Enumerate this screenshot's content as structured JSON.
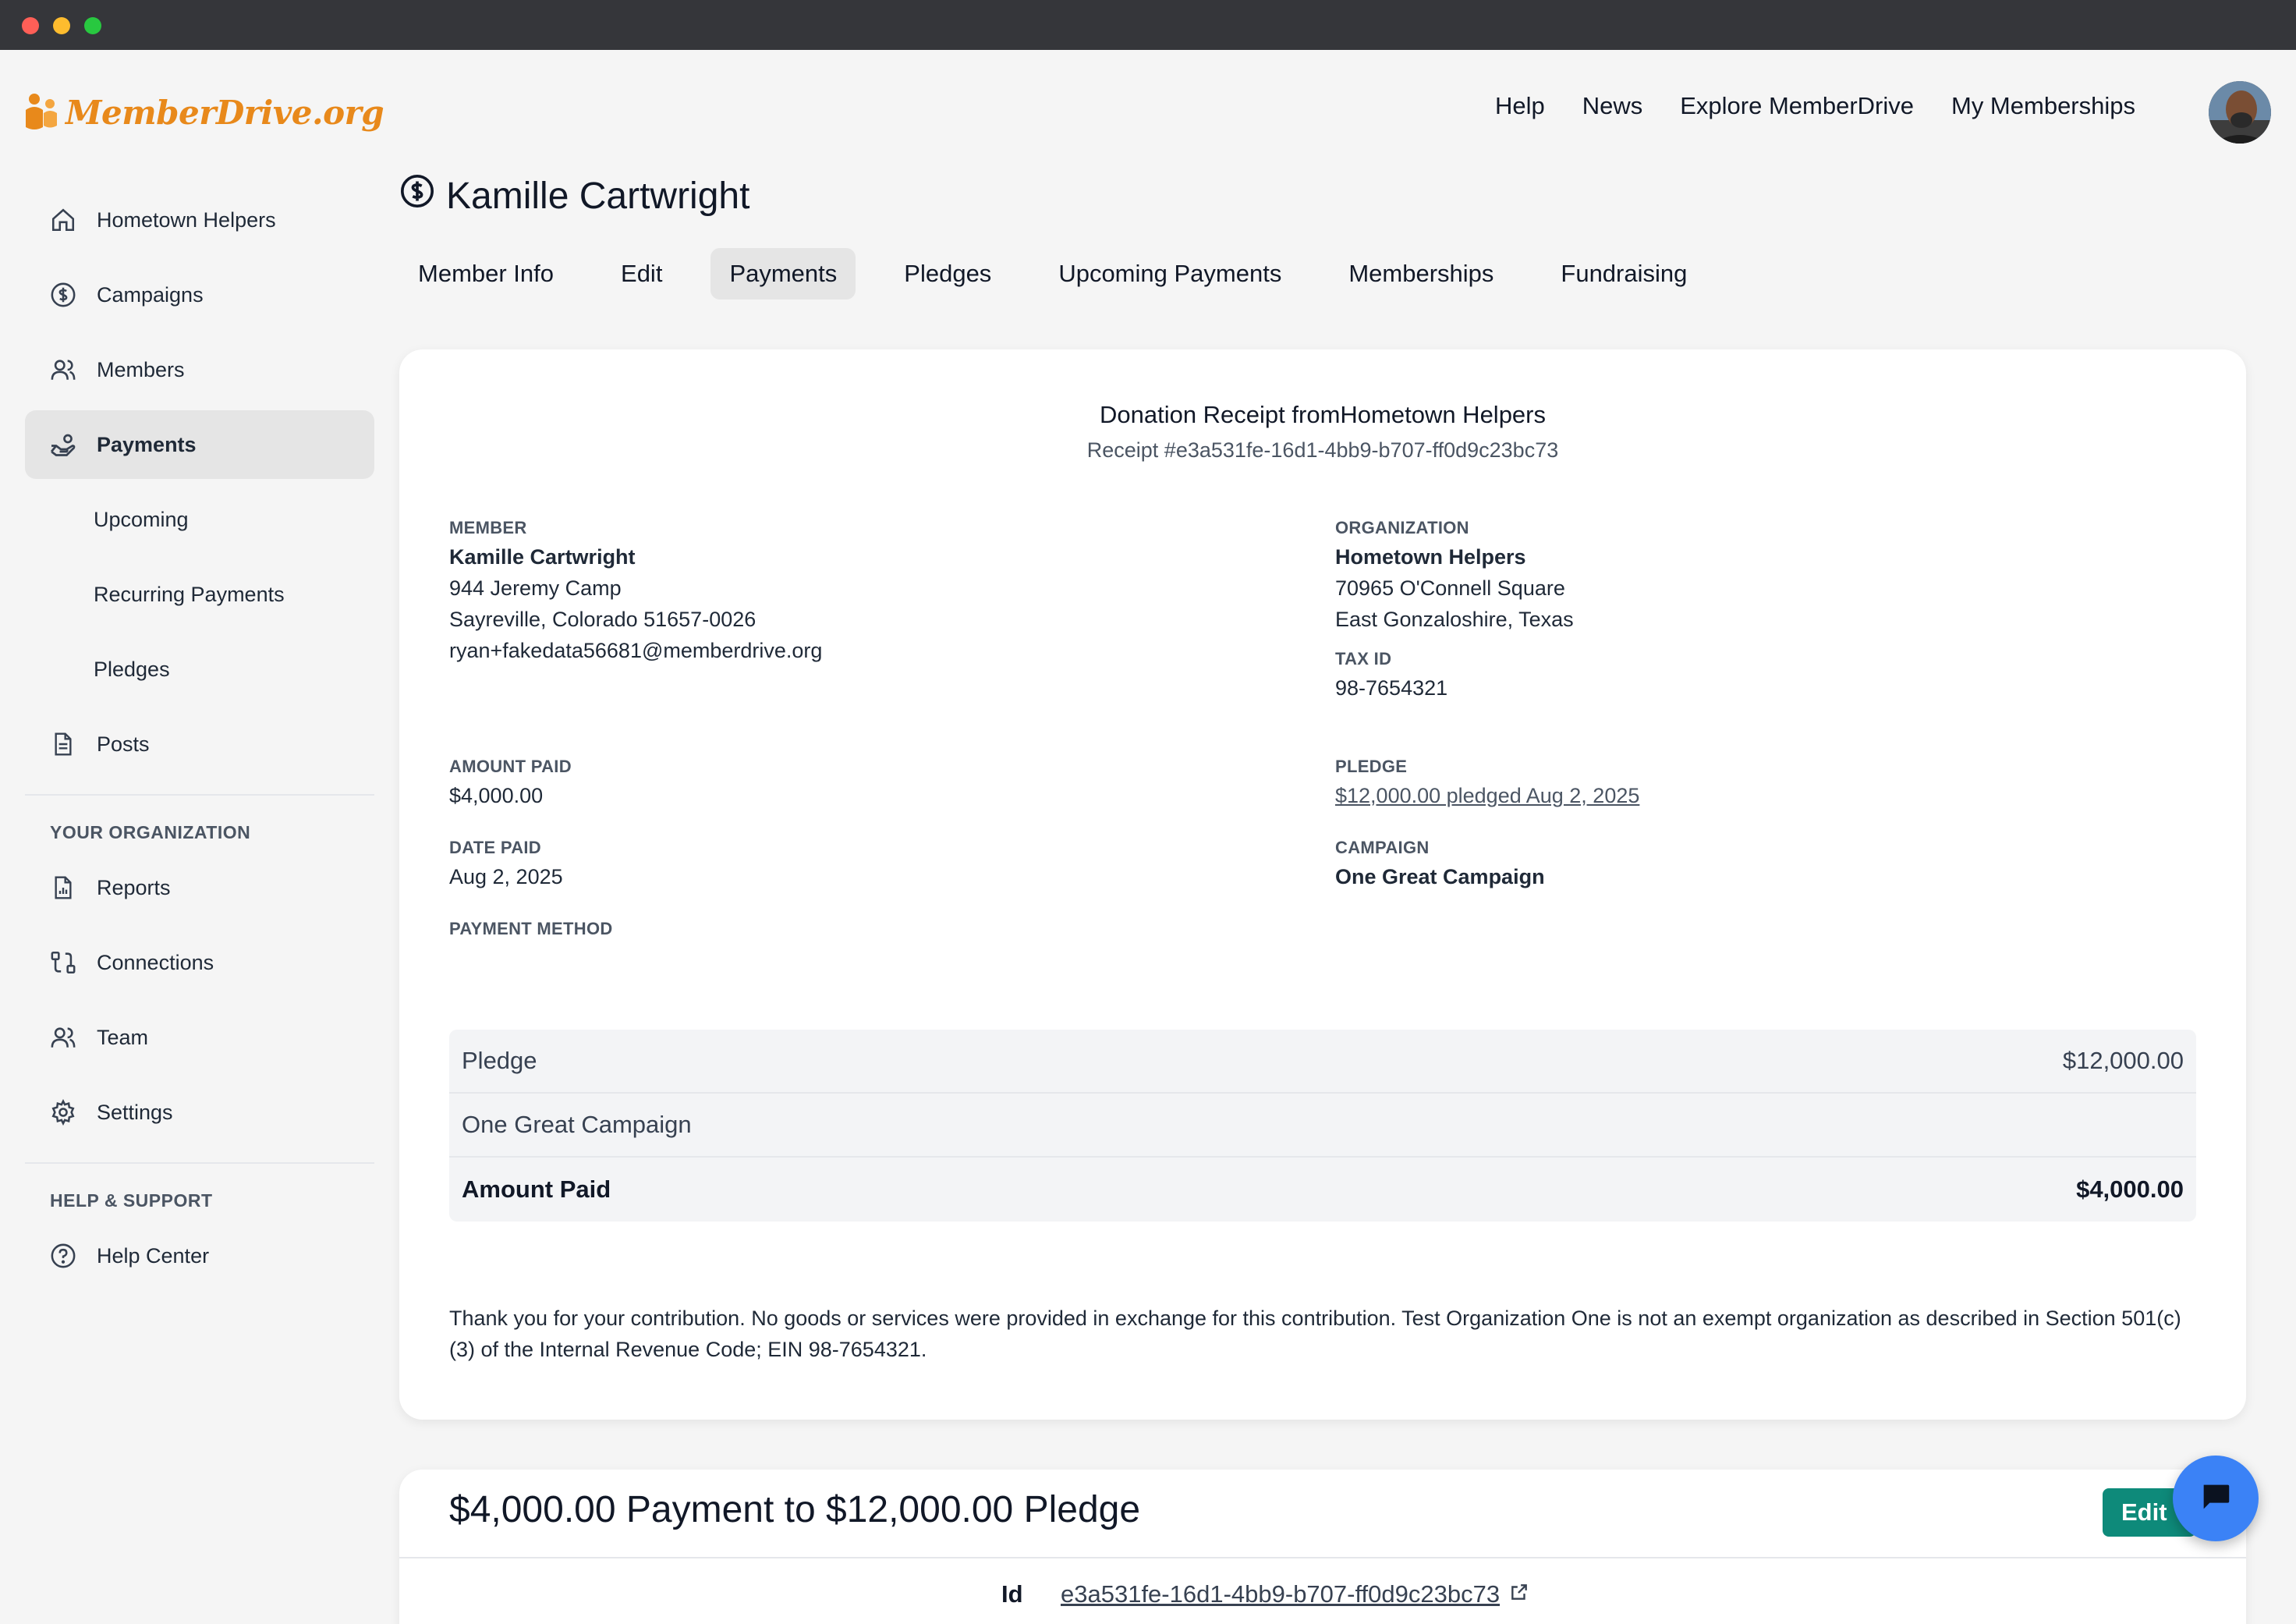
{
  "brand": {
    "name": "MemberDrive.org",
    "accent": "#e8891b"
  },
  "topnav": [
    "Help",
    "News",
    "Explore MemberDrive",
    "My Memberships"
  ],
  "sidebar": {
    "items": [
      {
        "label": "Hometown Helpers",
        "icon": "home-icon"
      },
      {
        "label": "Campaigns",
        "icon": "dollar-circle-icon"
      },
      {
        "label": "Members",
        "icon": "users-icon"
      },
      {
        "label": "Payments",
        "icon": "hand-coins-icon",
        "active": true
      },
      {
        "label": "Upcoming"
      },
      {
        "label": "Recurring Payments"
      },
      {
        "label": "Pledges"
      },
      {
        "label": "Posts",
        "icon": "document-icon"
      }
    ],
    "org_section": "YOUR ORGANIZATION",
    "org_items": [
      {
        "label": "Reports",
        "icon": "report-icon"
      },
      {
        "label": "Connections",
        "icon": "connections-icon"
      },
      {
        "label": "Team",
        "icon": "team-icon"
      },
      {
        "label": "Settings",
        "icon": "gear-icon"
      }
    ],
    "help_section": "HELP & SUPPORT",
    "help_items": [
      {
        "label": "Help Center",
        "icon": "question-circle-icon"
      }
    ]
  },
  "page": {
    "title": "Kamille Cartwright",
    "tabs": [
      "Member Info",
      "Edit",
      "Payments",
      "Pledges",
      "Upcoming Payments",
      "Memberships",
      "Fundraising"
    ],
    "active_tab": "Payments"
  },
  "receipt": {
    "title": "Donation Receipt fromHometown Helpers",
    "number": "Receipt #e3a531fe-16d1-4bb9-b707-ff0d9c23bc73",
    "member_label": "MEMBER",
    "member_name": "Kamille Cartwright",
    "member_address1": "944 Jeremy Camp",
    "member_address2": "Sayreville, Colorado 51657-0026",
    "member_email": "ryan+fakedata56681@memberdrive.org",
    "org_label": "ORGANIZATION",
    "org_name": "Hometown Helpers",
    "org_address1": "70965 O'Connell Square",
    "org_address2": "East Gonzaloshire, Texas",
    "tax_label": "TAX ID",
    "tax_id": "98-7654321",
    "amount_label": "AMOUNT PAID",
    "amount": "$4,000.00",
    "pledge_label": "PLEDGE",
    "pledge_link": "$12,000.00 pledged Aug 2, 2025",
    "date_label": "DATE PAID",
    "date": "Aug 2, 2025",
    "campaign_label": "CAMPAIGN",
    "campaign": "One Great Campaign",
    "method_label": "PAYMENT METHOD",
    "lines": [
      {
        "label": "Pledge",
        "value": "$12,000.00"
      },
      {
        "label": "One Great Campaign",
        "value": ""
      },
      {
        "label": "Amount Paid",
        "value": "$4,000.00"
      }
    ],
    "thanks": "Thank you for your contribution. No goods or services were provided in exchange for this contribution. Test Organization One is not an exempt organization as described in Section 501(c)(3) of the Internal Revenue Code; EIN 98-7654321."
  },
  "payment_card": {
    "title": "$4,000.00 Payment to $12,000.00 Pledge",
    "edit_label": "Edit",
    "id_label": "Id",
    "id_value": "e3a531fe-16d1-4bb9-b707-ff0d9c23bc73",
    "edit_color": "#0e8a7a"
  },
  "chat": {
    "icon": "chat-icon",
    "color": "#3b82f6"
  }
}
